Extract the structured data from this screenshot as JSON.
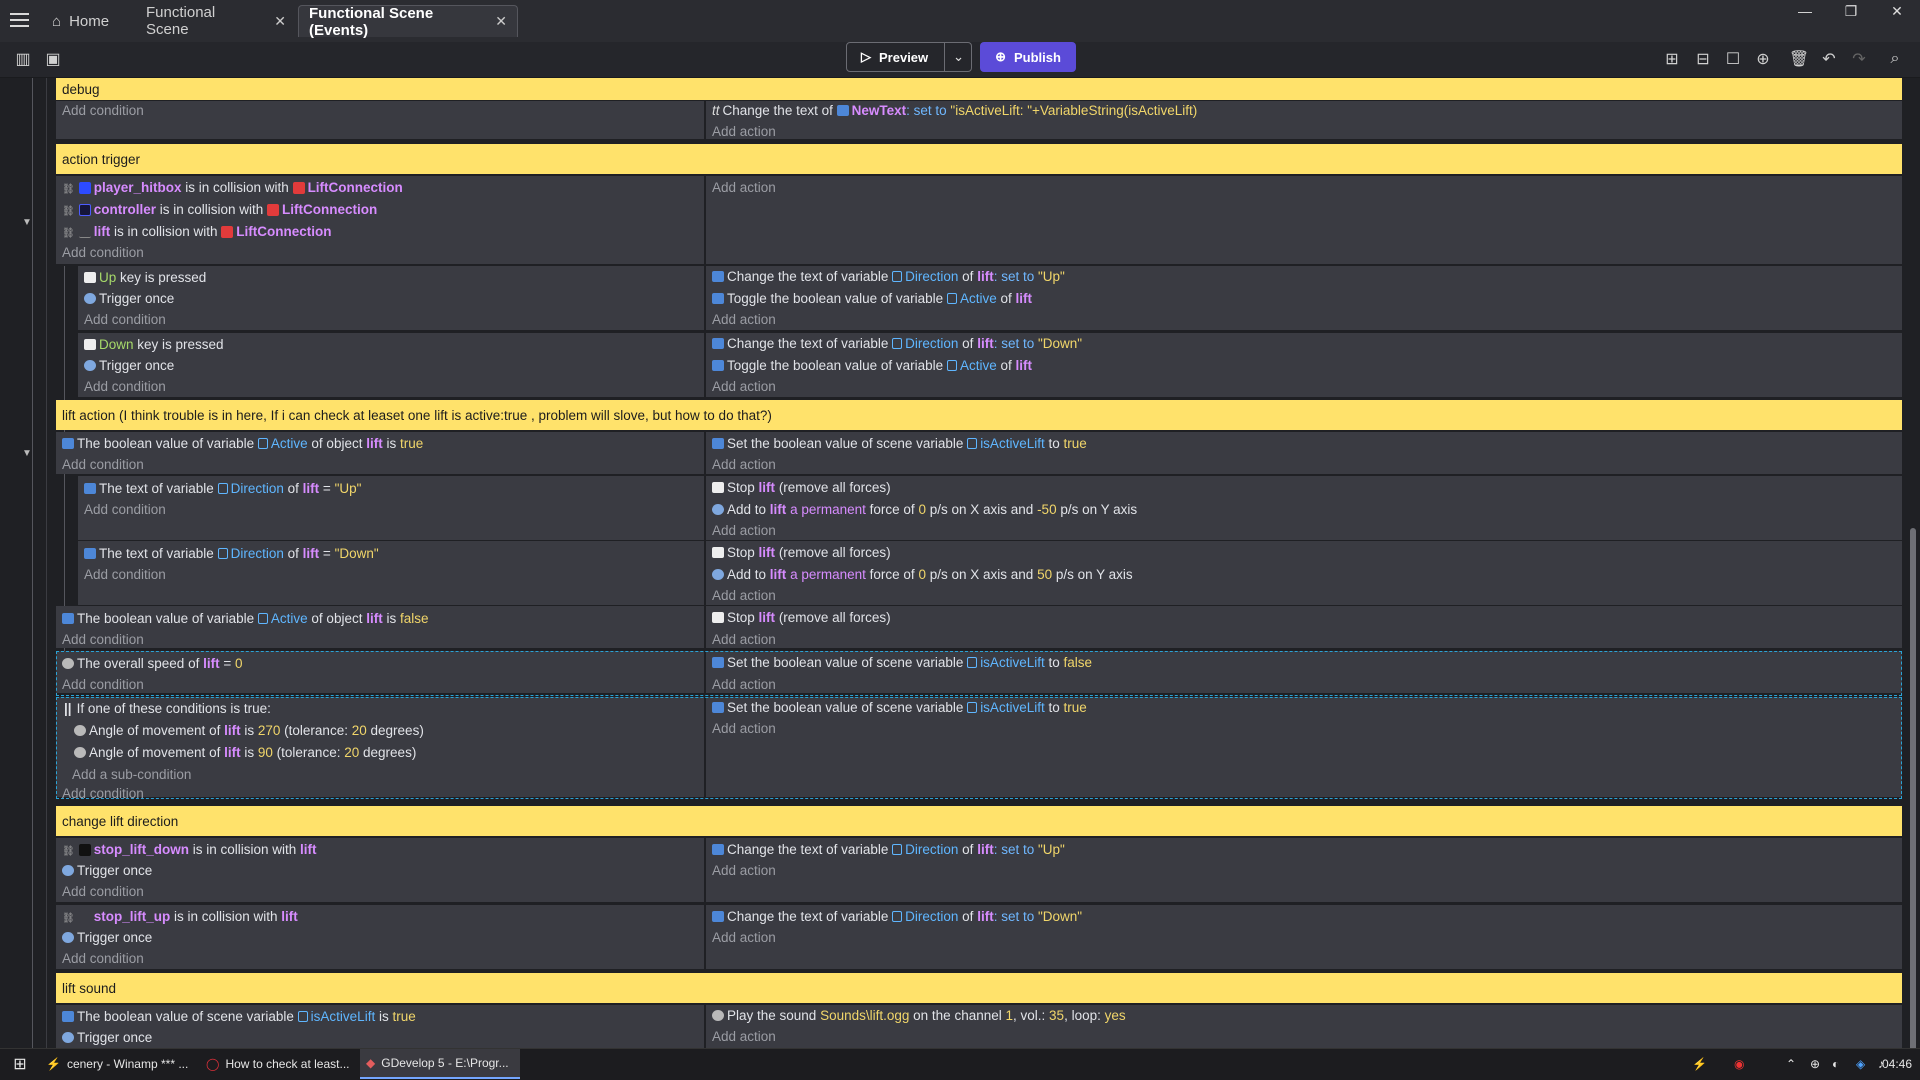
{
  "tabs": [
    {
      "label": "Home"
    },
    {
      "label": "Functional Scene"
    },
    {
      "label": "Functional Scene (Events)"
    }
  ],
  "toolbar": {
    "preview": "Preview",
    "publish": "Publish"
  },
  "labels": {
    "add_condition": "Add condition",
    "add_action": "Add action",
    "add_subcondition": "Add a sub-condition",
    "or_title": "If one of these conditions is true:"
  },
  "groups": {
    "debug": "debug",
    "action_trigger": "action trigger",
    "lift_action": "lift action (I think trouble is in here, If i can check at leaset one lift is active:true , problem will slove, but how to do that?)",
    "change_dir": "change lift direction",
    "lift_sound": "lift sound"
  },
  "debug": {
    "action": {
      "pre": "Change the text of",
      "obj": "NewText",
      "mid": ": set to",
      "val": "\"isActiveLift: \"+VariableString(isActiveLift)"
    }
  },
  "trigger": {
    "c1": {
      "obj": "player_hitbox",
      "mid": "is in collision with",
      "obj2": "LiftConnection"
    },
    "c2": {
      "obj": "controller",
      "mid": "is in collision with",
      "obj2": "LiftConnection"
    },
    "c3": {
      "obj": "lift",
      "mid": "is in collision with",
      "obj2": "LiftConnection"
    },
    "up": {
      "key": "Up",
      "rest": "key is pressed",
      "once": "Trigger once",
      "a1": {
        "pre": "Change the text of variable",
        "var": "Direction",
        "of": "of",
        "obj": "lift",
        "set": ": set to",
        "val": "\"Up\""
      },
      "a2": {
        "pre": "Toggle the boolean value of variable",
        "var": "Active",
        "of": "of",
        "obj": "lift"
      }
    },
    "down": {
      "key": "Down",
      "rest": "key is pressed",
      "once": "Trigger once",
      "a1": {
        "pre": "Change the text of variable",
        "var": "Direction",
        "of": "of",
        "obj": "lift",
        "set": ": set to",
        "val": "\"Down\""
      },
      "a2": {
        "pre": "Toggle the boolean value of variable",
        "var": "Active",
        "of": "of",
        "obj": "lift"
      }
    }
  },
  "liftaction": {
    "active_true": {
      "pre": "The boolean value of variable",
      "var": "Active",
      "mid": "of object",
      "obj": "lift",
      "is": "is",
      "val": "true",
      "act": {
        "pre": "Set the boolean value of scene variable",
        "var": "isActiveLift",
        "to": "to",
        "val": "true"
      }
    },
    "dir_up": {
      "pre": "The text of variable",
      "var": "Direction",
      "of": "of",
      "obj": "lift",
      "eq": "=",
      "val": "\"Up\"",
      "stop": {
        "pre": "Stop",
        "obj": "lift",
        "rest": "(remove all forces)"
      },
      "force": {
        "pre": "Add to",
        "obj": "lift",
        "mid": "a permanent",
        "r1": "force of",
        "x": "0",
        "r2": "p/s on X axis and",
        "y": "-50",
        "r3": "p/s on Y axis"
      }
    },
    "dir_down": {
      "pre": "The text of variable",
      "var": "Direction",
      "of": "of",
      "obj": "lift",
      "eq": "=",
      "val": "\"Down\"",
      "stop": {
        "pre": "Stop",
        "obj": "lift",
        "rest": "(remove all forces)"
      },
      "force": {
        "pre": "Add to",
        "obj": "lift",
        "mid": "a permanent",
        "r1": "force of",
        "x": "0",
        "r2": "p/s on X axis and",
        "y": "50",
        "r3": "p/s on Y axis"
      }
    },
    "active_false": {
      "pre": "The boolean value of variable",
      "var": "Active",
      "mid": "of object",
      "obj": "lift",
      "is": "is",
      "val": "false",
      "stop": {
        "pre": "Stop",
        "obj": "lift",
        "rest": "(remove all forces)"
      }
    },
    "speed": {
      "pre": "The overall speed of",
      "obj": "lift",
      "eq": "=",
      "val": "0",
      "act": {
        "pre": "Set the boolean value of scene variable",
        "var": "isActiveLift",
        "to": "to",
        "val": "false"
      }
    },
    "or": {
      "a1": {
        "pre": "Angle of movement of",
        "obj": "lift",
        "is": "is",
        "val": "270",
        "t1": "(tolerance:",
        "tol": "20",
        "t2": "degrees)"
      },
      "a2": {
        "pre": "Angle of movement of",
        "obj": "lift",
        "is": "is",
        "val": "90",
        "t1": "(tolerance:",
        "tol": "20",
        "t2": "degrees)"
      },
      "act": {
        "pre": "Set the boolean value of scene variable",
        "var": "isActiveLift",
        "to": "to",
        "val": "true"
      }
    }
  },
  "changedir": {
    "e1": {
      "obj": "stop_lift_down",
      "mid": "is in collision with",
      "obj2": "lift",
      "once": "Trigger once",
      "act": {
        "pre": "Change the text of variable",
        "var": "Direction",
        "of": "of",
        "obj": "lift",
        "set": ": set to",
        "val": "\"Up\""
      }
    },
    "e2": {
      "obj": "stop_lift_up",
      "mid": "is in collision with",
      "obj2": "lift",
      "once": "Trigger once",
      "act": {
        "pre": "Change the text of variable",
        "var": "Direction",
        "of": "of",
        "obj": "lift",
        "set": ": set to",
        "val": "\"Down\""
      }
    }
  },
  "sound": {
    "c": {
      "pre": "The boolean value of scene variable",
      "var": "isActiveLift",
      "is": "is",
      "val": "true",
      "once": "Trigger once"
    },
    "act": {
      "pre": "Play the sound",
      "file": "Sounds\\lift.ogg",
      "r1": "on the channel",
      "ch": "1",
      "r2": ", vol.:",
      "vol": "35",
      "r3": ", loop:",
      "loop": "yes"
    }
  },
  "taskbar": [
    {
      "label": "cenery - Winamp *** ..."
    },
    {
      "label": "How to check at least..."
    },
    {
      "label": "GDevelop 5 - E:\\Progr..."
    }
  ],
  "clock": "04:46",
  "colors": {
    "comment": "#ffe26b",
    "publish": "#5b4bd8",
    "object": "#d78cff",
    "variable": "#5fb6ff",
    "value": "#f1d66a"
  }
}
